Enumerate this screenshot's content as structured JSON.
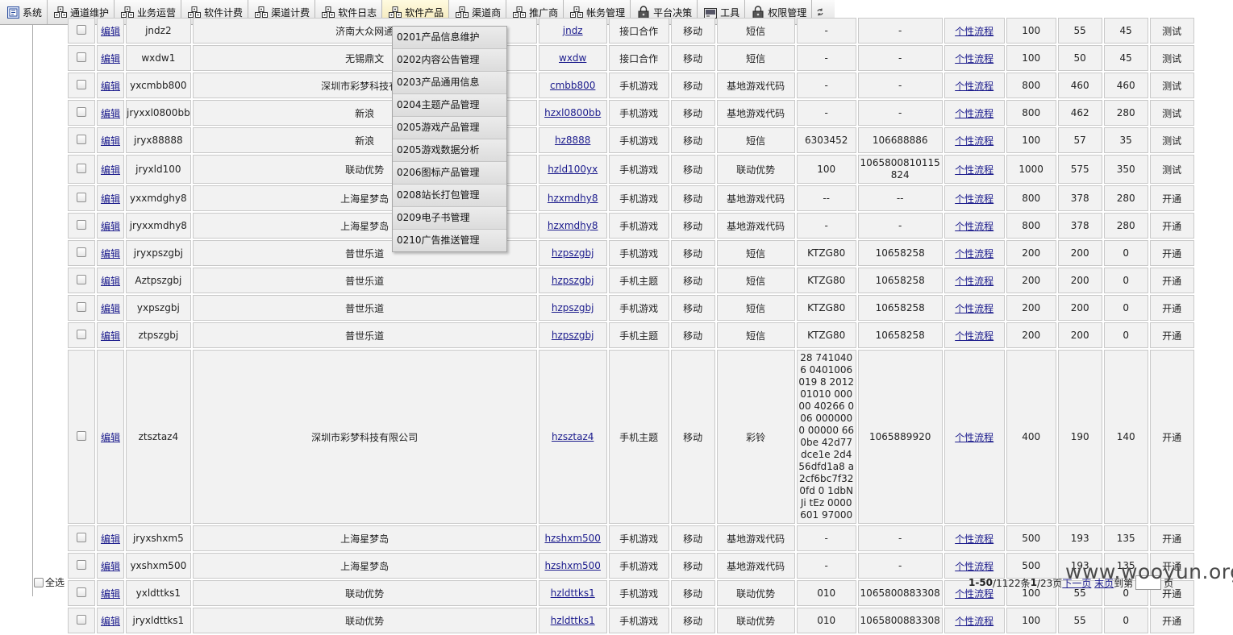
{
  "menu": [
    {
      "label": "系统",
      "icon": "system-icon"
    },
    {
      "label": "通道维护",
      "icon": "server-icon"
    },
    {
      "label": "业务运营",
      "icon": "server-icon"
    },
    {
      "label": "软件计费",
      "icon": "server-icon"
    },
    {
      "label": "渠道计费",
      "icon": "server-icon"
    },
    {
      "label": "软件日志",
      "icon": "server-icon"
    },
    {
      "label": "软件产品",
      "icon": "server-icon",
      "active": true
    },
    {
      "label": "渠道商",
      "icon": "server-icon"
    },
    {
      "label": "推广商",
      "icon": "server-icon"
    },
    {
      "label": "帐务管理",
      "icon": "server-icon"
    },
    {
      "label": "平台决策",
      "icon": "lock-icon"
    },
    {
      "label": "工具",
      "icon": "tools-icon"
    },
    {
      "label": "权限管理",
      "icon": "lock-icon"
    }
  ],
  "dropdown": [
    "0201产品信息维护",
    "0202内容公告管理",
    "0203产品通用信息",
    "0204主题产品管理",
    "0205游戏产品管理",
    "0205游戏数据分析",
    "0206图标产品管理",
    "0208站长打包管理",
    "0209电子书管理",
    "0210广告推送管理"
  ],
  "table": {
    "edit_label": "编辑",
    "flow_label": "个性流程",
    "rows": [
      {
        "code": "jndz2",
        "company": "济南大众网通",
        "link": "jndz",
        "type": "接口合作",
        "carrier": "移动",
        "billing": "短信",
        "number": "-",
        "port": "-",
        "price": "100",
        "v1": "55",
        "v2": "45",
        "status": "测试"
      },
      {
        "code": "wxdw1",
        "company": "无锡鼎文",
        "link": "wxdw",
        "type": "接口合作",
        "carrier": "移动",
        "billing": "短信",
        "number": "-",
        "port": "-",
        "price": "100",
        "v1": "50",
        "v2": "45",
        "status": "测试"
      },
      {
        "code": "yxcmbb800",
        "company": "深圳市彩梦科技有限",
        "link": "cmbb800",
        "type": "手机游戏",
        "carrier": "移动",
        "billing": "基地游戏代码",
        "number": "-",
        "port": "-",
        "price": "800",
        "v1": "460",
        "v2": "460",
        "status": "测试"
      },
      {
        "code": "jryxxl0800bb",
        "company": "新浪",
        "link": "hzxl0800bb",
        "type": "手机游戏",
        "carrier": "移动",
        "billing": "基地游戏代码",
        "number": "-",
        "port": "-",
        "price": "800",
        "v1": "462",
        "v2": "280",
        "status": "测试"
      },
      {
        "code": "jryx88888",
        "company": "新浪",
        "link": "hz8888",
        "type": "手机游戏",
        "carrier": "移动",
        "billing": "短信",
        "number": "6303452",
        "port": "106688886",
        "price": "100",
        "v1": "57",
        "v2": "35",
        "status": "测试"
      },
      {
        "code": "jryxld100",
        "company": "联动优势",
        "link": "hzld100yx",
        "type": "手机游戏",
        "carrier": "移动",
        "billing": "联动优势",
        "number": "100",
        "port": "1065800810115824",
        "price": "1000",
        "v1": "575",
        "v2": "350",
        "status": "测试"
      },
      {
        "code": "yxxmdghy8",
        "company": "上海星梦岛",
        "link": "hzxmdhy8",
        "type": "手机游戏",
        "carrier": "移动",
        "billing": "基地游戏代码",
        "number": "--",
        "port": "--",
        "price": "800",
        "v1": "378",
        "v2": "280",
        "status": "开通"
      },
      {
        "code": "jryxxmdhy8",
        "company": "上海星梦岛",
        "link": "hzxmdhy8",
        "type": "手机游戏",
        "carrier": "移动",
        "billing": "基地游戏代码",
        "number": "-",
        "port": "-",
        "price": "800",
        "v1": "378",
        "v2": "280",
        "status": "开通"
      },
      {
        "code": "jryxpszgbj",
        "company": "普世乐道",
        "link": "hzpszgbj",
        "type": "手机游戏",
        "carrier": "移动",
        "billing": "短信",
        "number": "KTZG80",
        "port": "10658258",
        "price": "200",
        "v1": "200",
        "v2": "0",
        "status": "开通"
      },
      {
        "code": "Aztpszgbj",
        "company": "普世乐道",
        "link": "hzpszgbj",
        "type": "手机主题",
        "carrier": "移动",
        "billing": "短信",
        "number": "KTZG80",
        "port": "10658258",
        "price": "200",
        "v1": "200",
        "v2": "0",
        "status": "开通"
      },
      {
        "code": "yxpszgbj",
        "company": "普世乐道",
        "link": "hzpszgbj",
        "type": "手机游戏",
        "carrier": "移动",
        "billing": "短信",
        "number": "KTZG80",
        "port": "10658258",
        "price": "200",
        "v1": "200",
        "v2": "0",
        "status": "开通"
      },
      {
        "code": "ztpszgbj",
        "company": "普世乐道",
        "link": "hzpszgbj",
        "type": "手机主题",
        "carrier": "移动",
        "billing": "短信",
        "number": "KTZG80",
        "port": "10658258",
        "price": "200",
        "v1": "200",
        "v2": "0",
        "status": "开通"
      },
      {
        "code": "ztsztaz4",
        "company": "深圳市彩梦科技有限公司",
        "link": "hzsztaz4",
        "type": "手机主题",
        "carrier": "移动",
        "billing": "彩铃",
        "number": "28 741040 6 0401006019 8 201201010 00000 40266 006 0000000 00000 660be 42d77dce1e 2d456dfd1a8 a2cf6bc7f32 0fd 0 1dbNJi tEz 0000601 97000",
        "port": "1065889920",
        "price": "400",
        "v1": "190",
        "v2": "140",
        "status": "开通",
        "tall": true
      },
      {
        "code": "jryxshxm5",
        "company": "上海星梦岛",
        "link": "hzshxm500",
        "type": "手机游戏",
        "carrier": "移动",
        "billing": "基地游戏代码",
        "number": "-",
        "port": "-",
        "price": "500",
        "v1": "193",
        "v2": "135",
        "status": "开通"
      },
      {
        "code": "yxshxm500",
        "company": "上海星梦岛",
        "link": "hzshxm500",
        "type": "手机游戏",
        "carrier": "移动",
        "billing": "基地游戏代码",
        "number": "-",
        "port": "-",
        "price": "500",
        "v1": "193",
        "v2": "135",
        "status": "开通"
      },
      {
        "code": "yxldttks1",
        "company": "联动优势",
        "link": "hzldttks1",
        "type": "手机游戏",
        "carrier": "移动",
        "billing": "联动优势",
        "number": "010",
        "port": "1065800883308",
        "price": "100",
        "v1": "55",
        "v2": "0",
        "status": "开通"
      },
      {
        "code": "jryxldttks1",
        "company": "联动优势",
        "link": "hzldttks1",
        "type": "手机游戏",
        "carrier": "移动",
        "billing": "联动优势",
        "number": "010",
        "port": "1065800883308",
        "price": "100",
        "v1": "55",
        "v2": "0",
        "status": "开通"
      }
    ]
  },
  "footer": {
    "select_all": "全选",
    "range": "1-50",
    "total_text": "/1122条 ",
    "page_current": "1",
    "page_total_text": "/23页 ",
    "next_label": "下一页",
    "last_label": "末页",
    "goto_prefix": " 到第",
    "goto_suffix": "页"
  },
  "watermark": "www.wooyun.org"
}
